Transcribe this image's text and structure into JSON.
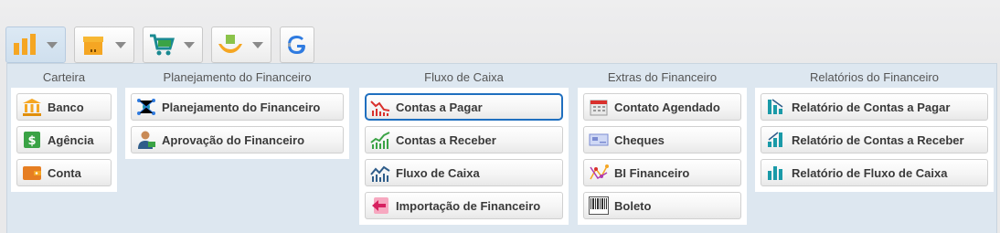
{
  "toolbar": {
    "buttons": [
      {
        "name": "financeiro-menu",
        "icon": "bar-chart-icon",
        "active": true
      },
      {
        "name": "estoque-menu",
        "icon": "box-icon",
        "active": false
      },
      {
        "name": "vendas-menu",
        "icon": "shopping-cart-icon",
        "active": false
      },
      {
        "name": "cadastros-menu",
        "icon": "hands-box-icon",
        "active": false
      },
      {
        "name": "google-button",
        "icon": "google-g-icon",
        "active": false
      }
    ]
  },
  "menu": {
    "carteira": {
      "title": "Carteira",
      "items": [
        {
          "label": "Banco",
          "icon": "bank-icon"
        },
        {
          "label": "Agência",
          "icon": "dollar-badge-icon"
        },
        {
          "label": "Conta",
          "icon": "wallet-icon"
        }
      ]
    },
    "planejamento": {
      "title": "Planejamento do Financeiro",
      "items": [
        {
          "label": "Planejamento do Financeiro",
          "icon": "network-icon"
        },
        {
          "label": "Aprovação do Financeiro",
          "icon": "person-money-icon"
        }
      ]
    },
    "fluxo": {
      "title": "Fluxo de Caixa",
      "items": [
        {
          "label": "Contas a Pagar",
          "icon": "chart-down-icon",
          "selected": true
        },
        {
          "label": "Contas a Receber",
          "icon": "chart-up-icon"
        },
        {
          "label": "Fluxo de Caixa",
          "icon": "chart-flow-icon"
        },
        {
          "label": "Importação de Financeiro",
          "icon": "import-arrow-icon"
        }
      ]
    },
    "extras": {
      "title": "Extras do Financeiro",
      "items": [
        {
          "label": "Contato Agendado",
          "icon": "calendar-icon"
        },
        {
          "label": "Cheques",
          "icon": "cheque-icon"
        },
        {
          "label": "BI Financeiro",
          "icon": "bi-graph-icon"
        },
        {
          "label": "Boleto",
          "icon": "barcode-icon"
        }
      ]
    },
    "relatorios": {
      "title": "Relatórios do Financeiro",
      "items": [
        {
          "label": "Relatório de Contas a Pagar",
          "icon": "report-down-icon"
        },
        {
          "label": "Relatório de Contas a Receber",
          "icon": "report-up-icon"
        },
        {
          "label": "Relatório de Fluxo de Caixa",
          "icon": "report-flow-icon"
        }
      ]
    }
  },
  "colors": {
    "accent": "#1f6fbf",
    "panel": "#dde7f0",
    "orange": "#f5a623",
    "green": "#3aa345",
    "teal": "#1a9aa8"
  }
}
